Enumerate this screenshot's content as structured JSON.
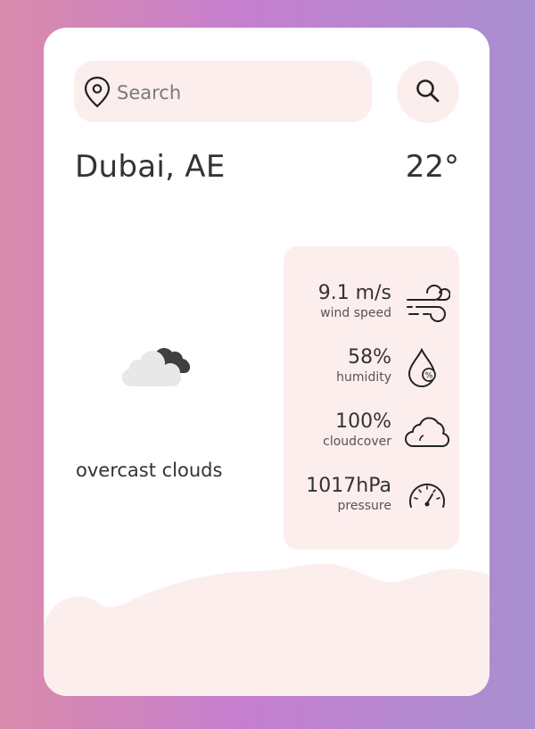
{
  "search": {
    "placeholder": "Search",
    "value": ""
  },
  "location": {
    "city": "Dubai, AE",
    "temperature": "22°"
  },
  "condition": {
    "description": "overcast clouds",
    "icon": "overcast-clouds-icon"
  },
  "stats": [
    {
      "value": "9.1 m/s",
      "label": "wind speed",
      "icon": "wind-icon"
    },
    {
      "value": "58%",
      "label": "humidity",
      "icon": "humidity-drop-icon"
    },
    {
      "value": "100%",
      "label": "cloudcover",
      "icon": "cloud-icon"
    },
    {
      "value": "1017hPa",
      "label": "pressure",
      "icon": "gauge-icon"
    }
  ],
  "colors": {
    "accent_bg": "#fdeeee",
    "text": "#333333",
    "gradient_left": "#d98aaa",
    "gradient_right": "#a88fd0"
  }
}
